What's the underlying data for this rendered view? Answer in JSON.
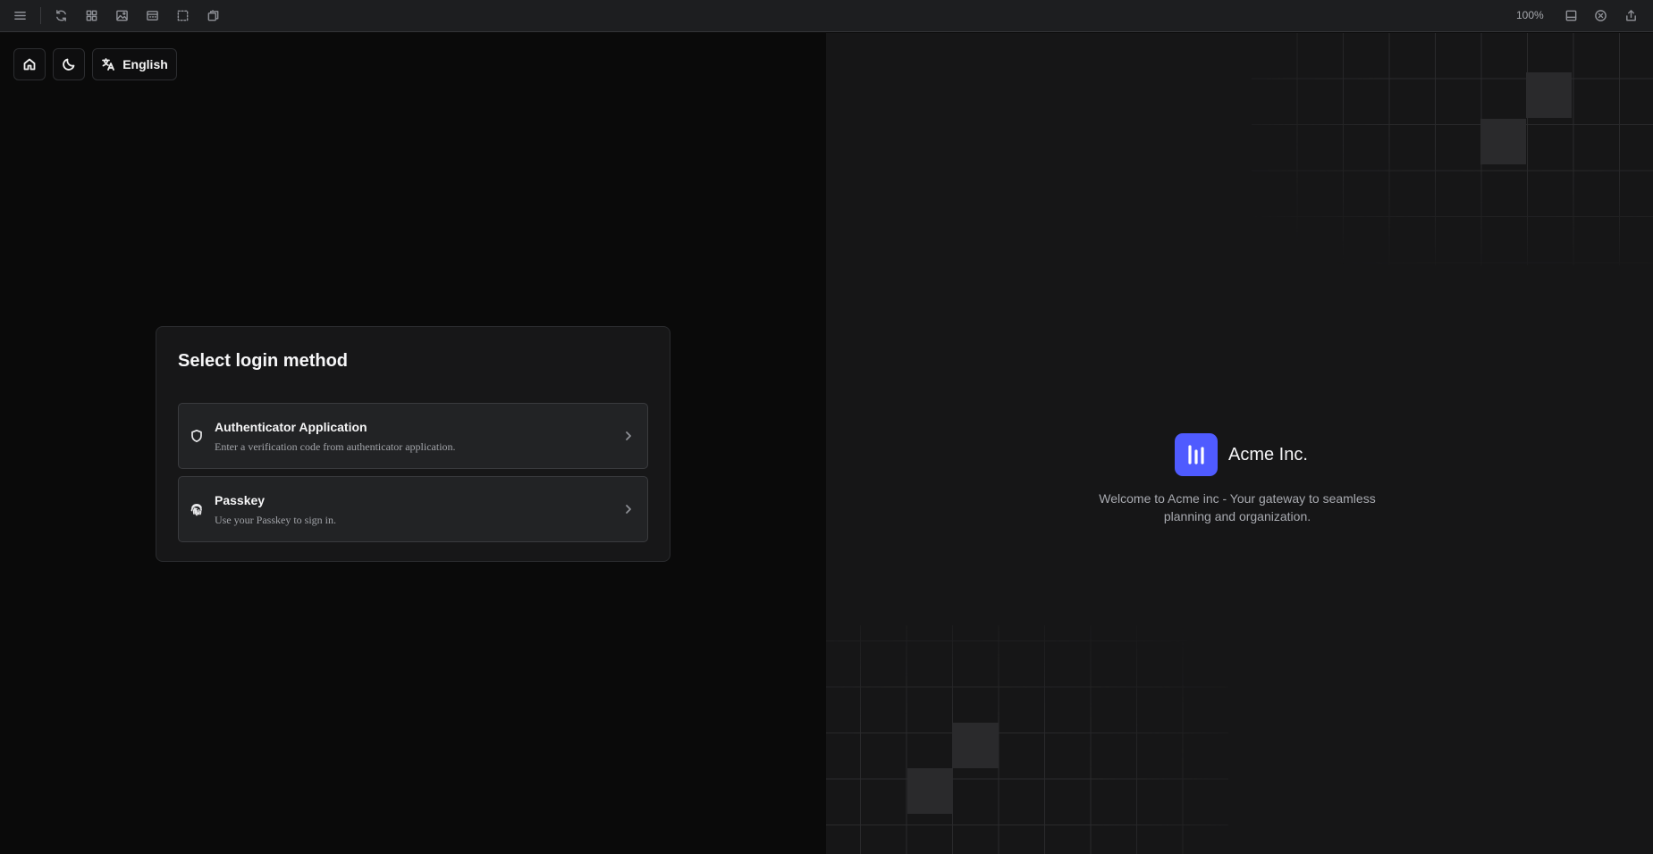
{
  "toolbar": {
    "left_icons": [
      "menu-icon",
      "refresh-icon",
      "grid-icon",
      "image-icon",
      "layout-icon",
      "selection-icon",
      "copy-icon"
    ],
    "zoom": "100%",
    "right_icons": [
      "panel-icon",
      "close-circle-icon",
      "share-icon"
    ]
  },
  "nav": {
    "home_icon": "home-icon",
    "theme_icon": "moon-icon",
    "language_icon": "translate-icon",
    "language_label": "English"
  },
  "login": {
    "title": "Select login method",
    "methods": [
      {
        "icon": "shield-icon",
        "title": "Authenticator Application",
        "description": "Enter a verification code from authenticator application."
      },
      {
        "icon": "fingerprint-icon",
        "title": "Passkey",
        "description": "Use your Passkey to sign in."
      }
    ]
  },
  "brand": {
    "name": "Acme Inc.",
    "logo_color": "#4f5bff",
    "tagline": "Welcome to Acme inc - Your gateway to seamless planning and organization."
  },
  "colors": {
    "left_background": "#0a0a0a",
    "right_background": "#161617",
    "card_background": "#171718",
    "method_background": "#222325",
    "accent": "#4f5bff"
  }
}
